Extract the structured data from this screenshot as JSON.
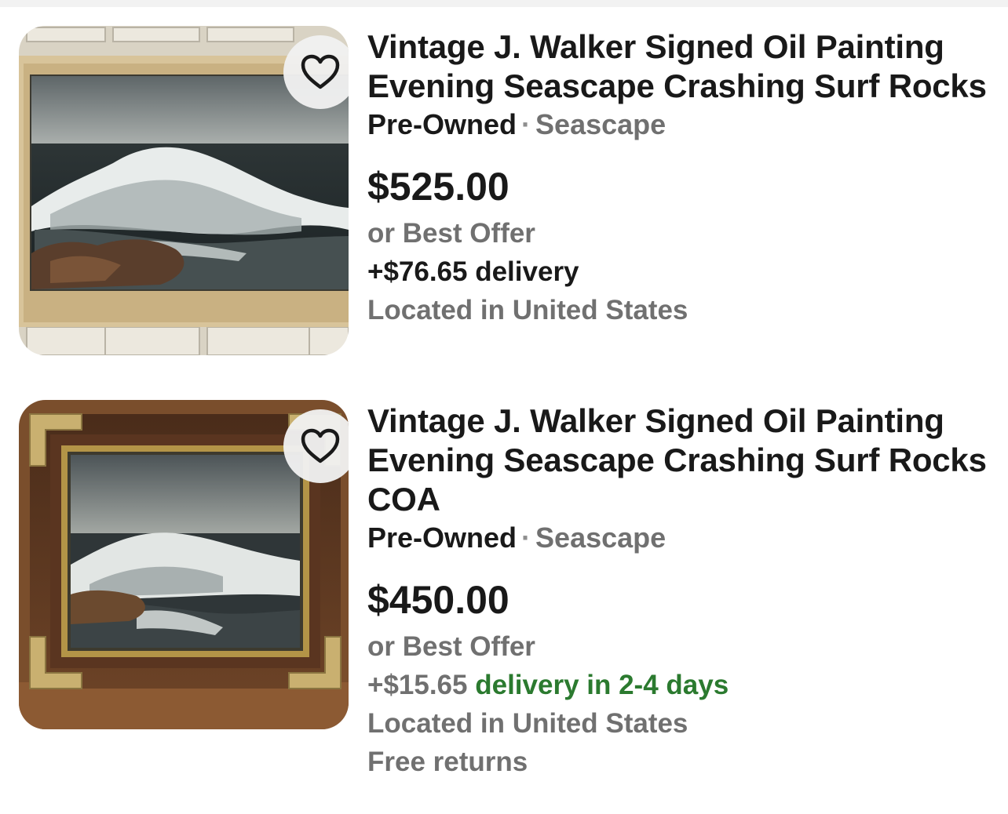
{
  "listings": [
    {
      "title": "Vintage J. Walker Signed Oil Painting Evening Seascape Crashing Surf Rocks",
      "condition": "Pre-Owned",
      "separator": "·",
      "category": "Seascape",
      "price": "$525.00",
      "offer": "or Best Offer",
      "shipping": "+$76.65 delivery",
      "location": "Located in United States"
    },
    {
      "title": "Vintage J. Walker Signed Oil Painting Evening Seascape Crashing Surf Rocks COA",
      "condition": "Pre-Owned",
      "separator": "·",
      "category": "Seascape",
      "price": "$450.00",
      "offer": "or Best Offer",
      "shipping_cost": "+$15.65",
      "shipping_speed": "delivery in 2-4 days",
      "location": "Located in United States",
      "returns": "Free returns"
    }
  ],
  "icons": {
    "favorite": "heart-outline-icon"
  },
  "colors": {
    "text_primary": "#191919",
    "text_secondary": "#707070",
    "fast_delivery_green": "#2b7a2f"
  }
}
